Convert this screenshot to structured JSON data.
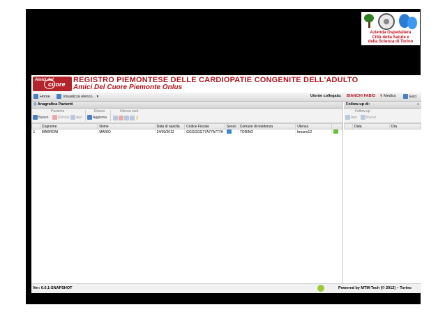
{
  "header": {
    "org_text": "Azienda Ospedaliera\nCittà della Salute e\ndella Scienza di Torino"
  },
  "banner": {
    "logo_top": "Amici del",
    "logo_main": "cuore",
    "title": "REGISTRO PIEMONTESE DELLE CARDIOPATIE CONGENITE DELL'ADULTO",
    "subtitle": "Amici Del Cuore Piemonte Onlus"
  },
  "toolbar": {
    "home": "Home",
    "view_list": "Visualizza elenco... ▾",
    "user_label": "Utente collegato:",
    "user_name": "BIANCHI FABIO",
    "role": "Medico",
    "exit": "Esci"
  },
  "patients_panel": {
    "title": "Anagrafica Pazienti",
    "groups": {
      "paziente": "Paziente",
      "elenco": "Elenco",
      "utenza": "Utenza web"
    },
    "buttons": {
      "nuovo": "Nuovo",
      "elimina": "Elimina",
      "apri": "Apri",
      "aggiorna": "Aggiorna"
    },
    "columns": [
      "Cognome",
      "Nome",
      "Data di nascita",
      "Codice Fiscale",
      "Sesso",
      "Comune di residenza",
      "Utenza"
    ],
    "rows": [
      {
        "n": "1",
        "cognome": "MARRONI",
        "nome": "MARIO",
        "nascita": "24/09/2012",
        "cf": "GGGGGG77A77A777A",
        "comune": "TORINO",
        "utenza": "bmario12"
      }
    ]
  },
  "followup_panel": {
    "title": "Follow-up di:",
    "group": "Follow-up",
    "buttons": {
      "apri": "Apri",
      "nuovo": "Nuovo"
    },
    "columns": [
      "Data",
      "Ora"
    ]
  },
  "footer": {
    "version": "Ver: 0.0,1-SNAPSHOT",
    "powered": "Powered by MTM-Tech (© 2012) – Torino"
  }
}
